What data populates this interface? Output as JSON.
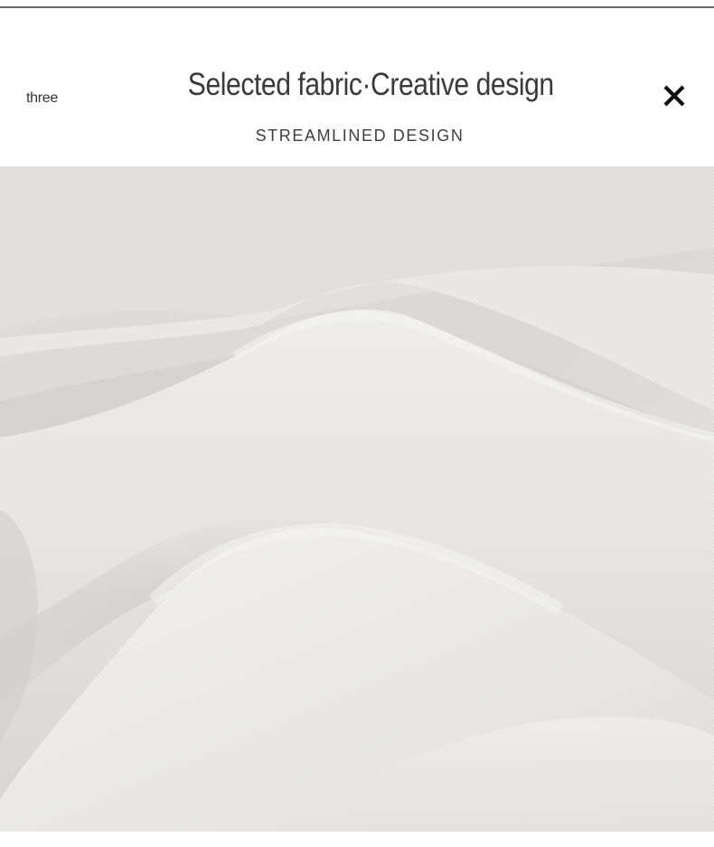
{
  "header": {
    "side_label": "three",
    "title": "Selected fabric·Creative design",
    "subtitle": "STREAMLINED DESIGN",
    "close_icon": "close-icon"
  },
  "image": {
    "subject": "fabric-photo",
    "fabric_color": "#e6e4e1",
    "shadow_color": "#cfcdca",
    "highlight_color": "#f3f2f0"
  }
}
